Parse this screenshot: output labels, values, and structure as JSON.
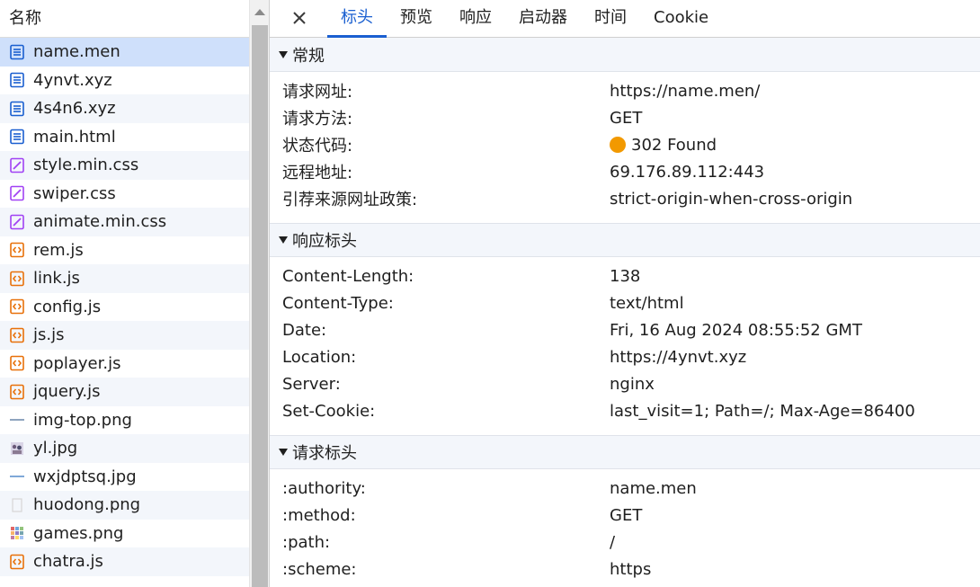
{
  "list": {
    "header": "名称",
    "items": [
      {
        "name": "name.men",
        "type": "doc"
      },
      {
        "name": "4ynvt.xyz",
        "type": "doc"
      },
      {
        "name": "4s4n6.xyz",
        "type": "doc"
      },
      {
        "name": "main.html",
        "type": "doc"
      },
      {
        "name": "style.min.css",
        "type": "css"
      },
      {
        "name": "swiper.css",
        "type": "css"
      },
      {
        "name": "animate.min.css",
        "type": "css"
      },
      {
        "name": "rem.js",
        "type": "js"
      },
      {
        "name": "link.js",
        "type": "js"
      },
      {
        "name": "config.js",
        "type": "js"
      },
      {
        "name": "js.js",
        "type": "js"
      },
      {
        "name": "poplayer.js",
        "type": "js"
      },
      {
        "name": "jquery.js",
        "type": "js"
      },
      {
        "name": "img-top.png",
        "type": "img-line"
      },
      {
        "name": "yl.jpg",
        "type": "img-thumb"
      },
      {
        "name": "wxjdptsq.jpg",
        "type": "img-line-blue"
      },
      {
        "name": "huodong.png",
        "type": "img-blank"
      },
      {
        "name": "games.png",
        "type": "img-grid"
      },
      {
        "name": "chatra.js",
        "type": "js"
      }
    ]
  },
  "tabs": [
    "标头",
    "预览",
    "响应",
    "启动器",
    "时间",
    "Cookie"
  ],
  "sections": {
    "general": {
      "title": "常规",
      "rows": [
        {
          "k": "请求网址:",
          "v": "https://name.men/"
        },
        {
          "k": "请求方法:",
          "v": "GET"
        },
        {
          "k": "状态代码:",
          "v": "302 Found"
        },
        {
          "k": "远程地址:",
          "v": "69.176.89.112:443"
        },
        {
          "k": "引荐来源网址政策:",
          "v": "strict-origin-when-cross-origin"
        }
      ]
    },
    "response": {
      "title": "响应标头",
      "rows": [
        {
          "k": "Content-Length:",
          "v": "138"
        },
        {
          "k": "Content-Type:",
          "v": "text/html"
        },
        {
          "k": "Date:",
          "v": "Fri, 16 Aug 2024 08:55:52 GMT"
        },
        {
          "k": "Location:",
          "v": "https://4ynvt.xyz"
        },
        {
          "k": "Server:",
          "v": "nginx"
        },
        {
          "k": "Set-Cookie:",
          "v": "last_visit=1; Path=/; Max-Age=86400"
        }
      ]
    },
    "request": {
      "title": "请求标头",
      "rows": [
        {
          "k": ":authority:",
          "v": "name.men"
        },
        {
          "k": ":method:",
          "v": "GET"
        },
        {
          "k": ":path:",
          "v": "/"
        },
        {
          "k": ":scheme:",
          "v": "https"
        }
      ]
    }
  },
  "colors": {
    "accent": "#1a5fd0",
    "selected_row": "#cfe0fb",
    "status_dot": "#f29900",
    "doc_icon": "#1a5fd0",
    "css_icon": "#a142f4",
    "js_icon": "#e8710a"
  }
}
